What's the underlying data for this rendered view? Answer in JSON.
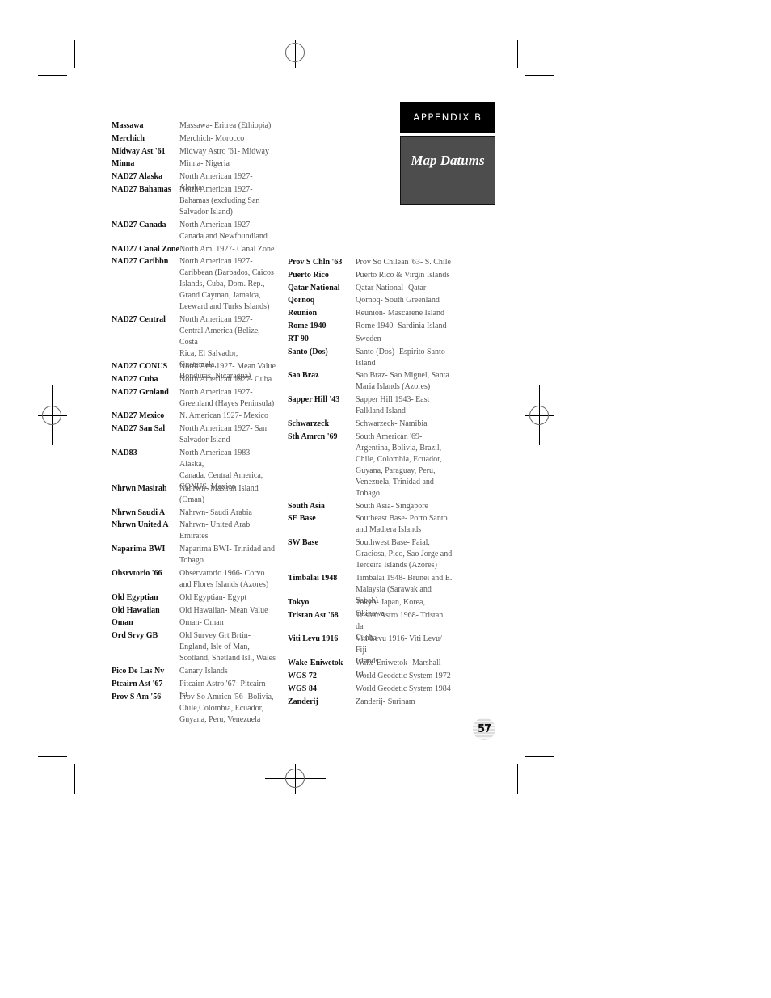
{
  "header": {
    "appendix_label": "APPENDIX B",
    "section_title": "Map Datums"
  },
  "page_number": "57",
  "left_column": [
    {
      "name": "Massawa",
      "desc": "Massawa- Eritrea (Ethiopia)"
    },
    {
      "name": "Merchich",
      "desc": "Merchich- Morocco"
    },
    {
      "name": "Midway Ast '61",
      "desc": "Midway Astro '61- Midway"
    },
    {
      "name": "Minna",
      "desc": "Minna- Nigeria"
    },
    {
      "name": "NAD27 Alaska",
      "desc": "North American 1927- Alaska"
    },
    {
      "name": "NAD27 Bahamas",
      "desc": "North American 1927-\nBahamas (excluding San\nSalvador Island)"
    },
    {
      "name": "NAD27 Canada",
      "desc": "North American 1927-\nCanada and Newfoundland"
    },
    {
      "name": "NAD27 Canal Zone",
      "desc": "North Am. 1927- Canal Zone"
    },
    {
      "name": "NAD27 Caribbn",
      "desc": "North American 1927-\nCaribbean (Barbados, Caicos\nIslands, Cuba, Dom. Rep.,\nGrand Cayman, Jamaica,\nLeeward and Turks Islands)"
    },
    {
      "name": "NAD27 Central",
      "desc": "North American 1927-\nCentral America (Belize, Costa\nRica, El Salvador, Guatemala,\nHonduras, Nicaragua)"
    },
    {
      "name": "NAD27 CONUS",
      "desc": "North Am. 1927- Mean Value"
    },
    {
      "name": "NAD27 Cuba",
      "desc": "North American 1927- Cuba"
    },
    {
      "name": "NAD27 Grnland",
      "desc": "North American 1927-\nGreenland (Hayes Peninsula)"
    },
    {
      "name": "NAD27 Mexico",
      "desc": "N. American 1927- Mexico"
    },
    {
      "name": "NAD27 San Sal",
      "desc": "North American 1927- San\nSalvador Island"
    },
    {
      "name": "NAD83",
      "desc": "North American 1983- Alaska,\nCanada, Central America,\nCONUS, Mexico"
    },
    {
      "name": "Nhrwn Masirah",
      "desc": "Nahrwn- Masirah Island\n(Oman)"
    },
    {
      "name": "Nhrwn Saudi A",
      "desc": "Nahrwn- Saudi Arabia"
    },
    {
      "name": "Nhrwn United A",
      "desc": "Nahrwn- United Arab\nEmirates"
    },
    {
      "name": "Naparima BWI",
      "desc": "Naparima BWI- Trinidad and\nTobago"
    },
    {
      "name": "Obsrvtorio '66",
      "desc": "Observatorio 1966- Corvo\nand Flores Islands (Azores)"
    },
    {
      "name": "Old Egyptian",
      "desc": "Old Egyptian- Egypt"
    },
    {
      "name": "Old Hawaiian",
      "desc": "Old Hawaiian- Mean Value"
    },
    {
      "name": "Oman",
      "desc": "Oman- Oman"
    },
    {
      "name": "Ord Srvy GB",
      "desc": "Old Survey Grt Brtin-\nEngland, Isle of Man,\nScotland, Shetland Isl., Wales"
    },
    {
      "name": "Pico De Las Nv",
      "desc": "Canary Islands"
    },
    {
      "name": "Ptcairn Ast '67",
      "desc": "Pitcairn Astro '67- Pitcairn Isl."
    },
    {
      "name": "Prov S Am '56",
      "desc": "Prov So Amricn '56- Bolivia,\nChile,Colombia, Ecuador,\nGuyana, Peru, Venezuela"
    }
  ],
  "right_column": [
    {
      "name": "Prov S Chln '63",
      "desc": "Prov So Chilean '63- S. Chile"
    },
    {
      "name": "Puerto Rico",
      "desc": "Puerto Rico & Virgin Islands"
    },
    {
      "name": "Qatar National",
      "desc": "Qatar National- Qatar"
    },
    {
      "name": "Qornoq",
      "desc": "Qornoq- South Greenland"
    },
    {
      "name": "Reunion",
      "desc": "Reunion- Mascarene Island"
    },
    {
      "name": "Rome 1940",
      "desc": "Rome 1940- Sardinia Island"
    },
    {
      "name": "RT 90",
      "desc": "Sweden"
    },
    {
      "name": "Santo (Dos)",
      "desc": "Santo (Dos)- Espirito Santo\nIsland"
    },
    {
      "name": "Sao Braz",
      "desc": "Sao Braz- Sao Miguel, Santa\nMaria Islands (Azores)"
    },
    {
      "name": "Sapper Hill '43",
      "desc": "Sapper Hill 1943- East\nFalkland Island"
    },
    {
      "name": "Schwarzeck",
      "desc": "Schwarzeck- Namibia"
    },
    {
      "name": "Sth Amrcn '69",
      "desc": "South American '69-\nArgentina, Bolivia, Brazil,\nChile, Colombia, Ecuador,\nGuyana, Paraguay, Peru,\nVenezuela, Trinidad and\nTobago"
    },
    {
      "name": "South Asia",
      "desc": "South Asia- Singapore"
    },
    {
      "name": "SE Base",
      "desc": "Southeast Base- Porto Santo\nand Madiera Islands"
    },
    {
      "name": "SW Base",
      "desc": "Southwest Base- Faial,\nGraciosa, Pico, Sao Jorge and\nTerceira Islands (Azores)"
    },
    {
      "name": "Timbalai 1948",
      "desc": "Timbalai 1948- Brunei and E.\nMalaysia (Sarawak and Sabah)"
    },
    {
      "name": "Tokyo",
      "desc": "Tokyo- Japan, Korea, Okinawa"
    },
    {
      "name": "Tristan Ast '68",
      "desc": "Tristan Astro 1968- Tristan da\nCunha"
    },
    {
      "name": "Viti Levu 1916",
      "desc": "Viti Levu 1916- Viti Levu/ Fiji\nIslands"
    },
    {
      "name": "Wake-Eniwetok",
      "desc": "Wake-Eniwetok- Marshall Isl."
    },
    {
      "name": "WGS 72",
      "desc": "World Geodetic System 1972"
    },
    {
      "name": "WGS 84",
      "desc": "World Geodetic System 1984"
    },
    {
      "name": "Zanderij",
      "desc": "Zanderij- Surinam"
    }
  ]
}
